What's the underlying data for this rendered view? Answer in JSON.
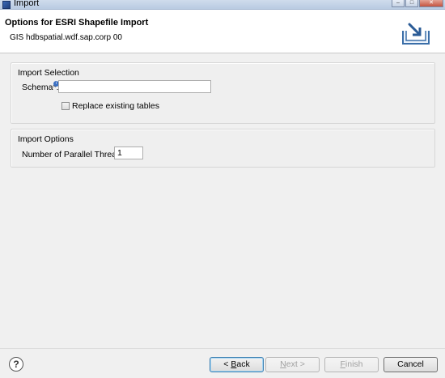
{
  "window": {
    "title": "Import"
  },
  "header": {
    "title": "Options for ESRI Shapefile Import",
    "description": "GIS hdbspatial.wdf.sap.corp 00"
  },
  "import_selection": {
    "legend": "Import Selection",
    "schema_label": "Schema*:",
    "schema_value": "",
    "replace_label": "Replace existing tables",
    "replace_checked": false
  },
  "import_options": {
    "legend": "Import Options",
    "threads_label": "Number of Parallel Threads:",
    "threads_value": "1"
  },
  "buttons": {
    "back_arrow": "< ",
    "back_mnemonic": "B",
    "back_rest": "ack",
    "next_mnemonic": "N",
    "next_rest": "ext >",
    "finish_mnemonic": "F",
    "finish_rest": "inish",
    "cancel": "Cancel",
    "help": "?"
  }
}
